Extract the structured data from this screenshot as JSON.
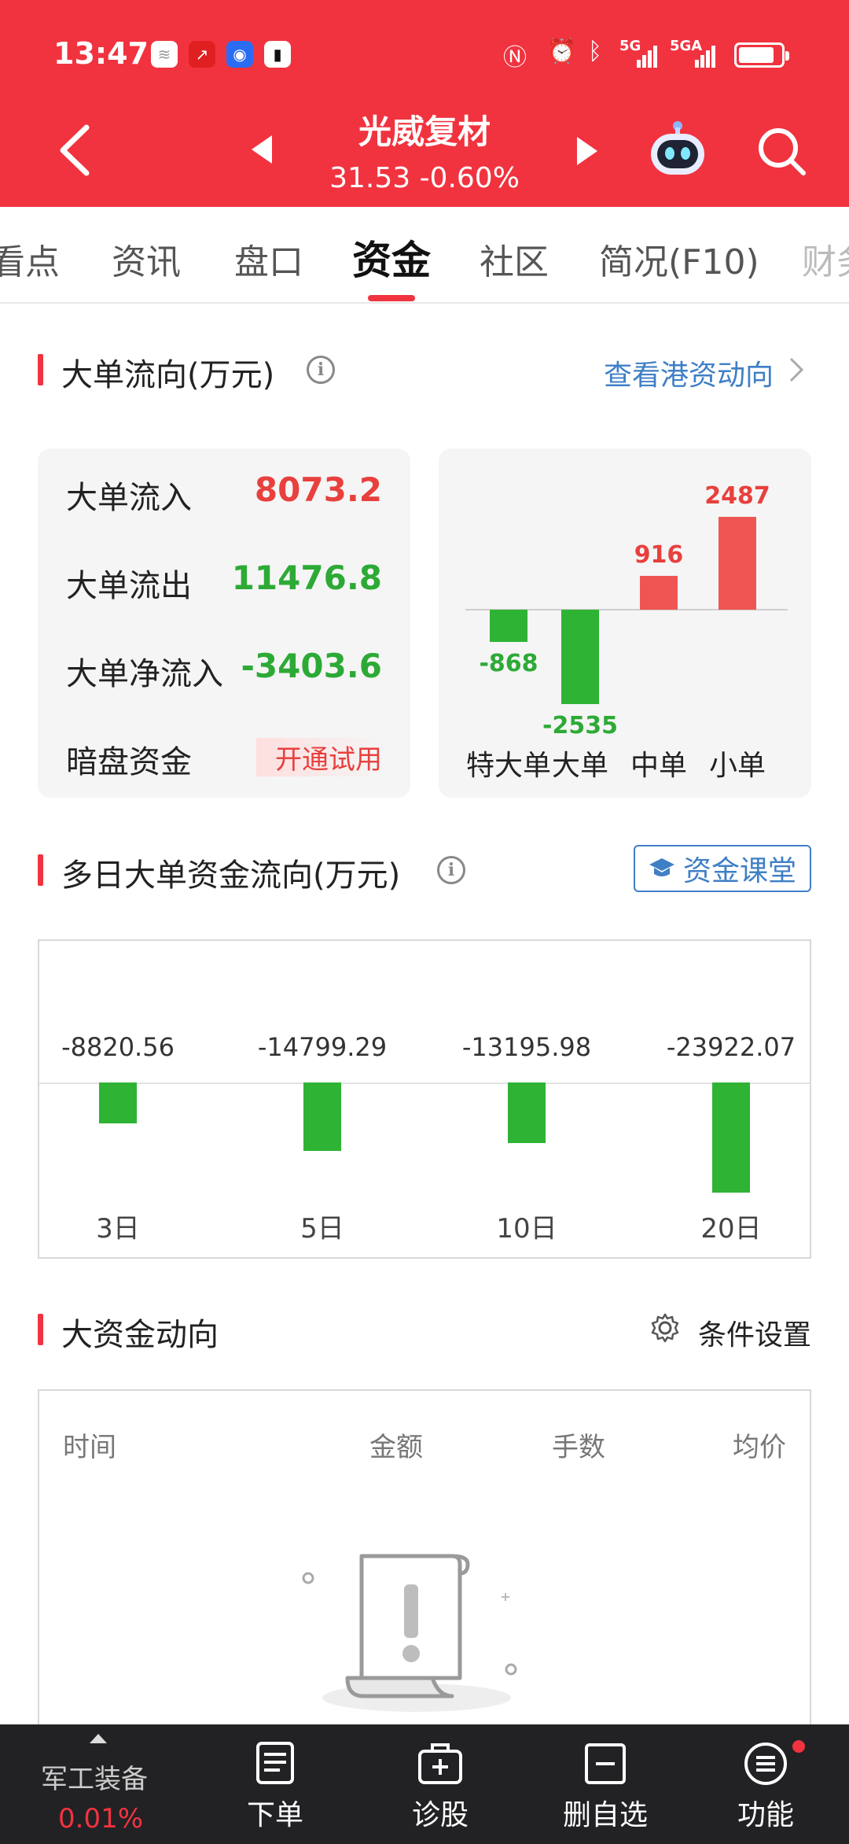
{
  "status_bar": {
    "time": "13:47",
    "network": "5G",
    "network2": "5GA"
  },
  "header": {
    "stock_name": "光威复材",
    "price_change": "31.53 -0.60%"
  },
  "tabs": [
    {
      "label": "看点"
    },
    {
      "label": "资讯"
    },
    {
      "label": "盘口"
    },
    {
      "label": "资金"
    },
    {
      "label": "社区"
    },
    {
      "label": "简况(F10)"
    },
    {
      "label": "财务"
    }
  ],
  "big_order_flow": {
    "title": "大单流向(万元)",
    "link": "查看港资动向",
    "rows": [
      {
        "label": "大单流入",
        "value": "8073.2"
      },
      {
        "label": "大单流出",
        "value": "11476.8"
      },
      {
        "label": "大单净流入",
        "value": "-3403.6"
      },
      {
        "label": "暗盘资金",
        "value": "开通试用"
      }
    ],
    "chart_data": {
      "type": "bar",
      "categories": [
        "特大单",
        "大单",
        "中单",
        "小单"
      ],
      "values": [
        -868,
        -2535,
        916,
        2487
      ]
    },
    "colors": {
      "positive": "#ef5553",
      "negative": "#2fb335"
    }
  },
  "multi_day_flow": {
    "title": "多日大单资金流向(万元)",
    "button": "资金课堂",
    "chart_data": {
      "type": "bar",
      "categories": [
        "3日",
        "5日",
        "10日",
        "20日"
      ],
      "values": [
        -8820.56,
        -14799.29,
        -13195.98,
        -23922.07
      ]
    }
  },
  "large_capital": {
    "title": "大资金动向",
    "settings": "条件设置",
    "columns": [
      "时间",
      "金额",
      "手数",
      "均价"
    ]
  },
  "bottom_nav": {
    "sector_name": "军工装备",
    "sector_change": "0.01%",
    "items": [
      {
        "label": "下单",
        "icon": "order-icon"
      },
      {
        "label": "诊股",
        "icon": "diagnose-icon"
      },
      {
        "label": "删自选",
        "icon": "remove-watchlist-icon"
      },
      {
        "label": "功能",
        "icon": "menu-icon"
      }
    ]
  }
}
